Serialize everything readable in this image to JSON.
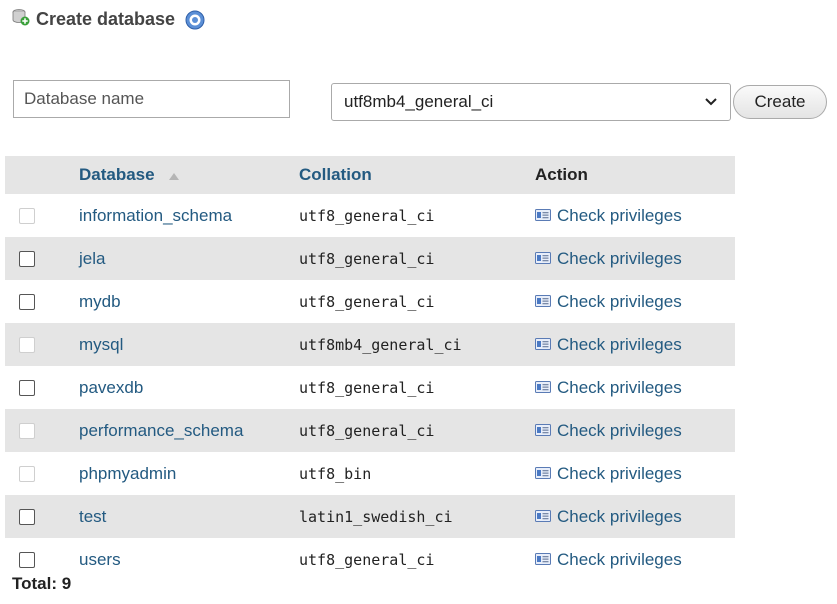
{
  "header": {
    "title": "Create database"
  },
  "create_form": {
    "name_placeholder": "Database name",
    "collation_selected": "utf8mb4_general_ci",
    "create_label": "Create"
  },
  "table": {
    "headers": {
      "database": "Database",
      "collation": "Collation",
      "action": "Action"
    },
    "rows": [
      {
        "name": "information_schema",
        "collation": "utf8_general_ci",
        "action": "Check privileges",
        "selectable": false
      },
      {
        "name": "jela",
        "collation": "utf8_general_ci",
        "action": "Check privileges",
        "selectable": true
      },
      {
        "name": "mydb",
        "collation": "utf8_general_ci",
        "action": "Check privileges",
        "selectable": true
      },
      {
        "name": "mysql",
        "collation": "utf8mb4_general_ci",
        "action": "Check privileges",
        "selectable": false
      },
      {
        "name": "pavexdb",
        "collation": "utf8_general_ci",
        "action": "Check privileges",
        "selectable": true
      },
      {
        "name": "performance_schema",
        "collation": "utf8_general_ci",
        "action": "Check privileges",
        "selectable": false
      },
      {
        "name": "phpmyadmin",
        "collation": "utf8_bin",
        "action": "Check privileges",
        "selectable": false
      },
      {
        "name": "test",
        "collation": "latin1_swedish_ci",
        "action": "Check privileges",
        "selectable": true
      },
      {
        "name": "users",
        "collation": "utf8_general_ci",
        "action": "Check privileges",
        "selectable": true
      }
    ]
  },
  "total_label": "Total: 9",
  "icons": {
    "header": "database-add-icon",
    "help": "help-icon",
    "sort": "sort-ascending-icon",
    "privileges": "privileges-icon",
    "select": "chevron-down-icon"
  }
}
